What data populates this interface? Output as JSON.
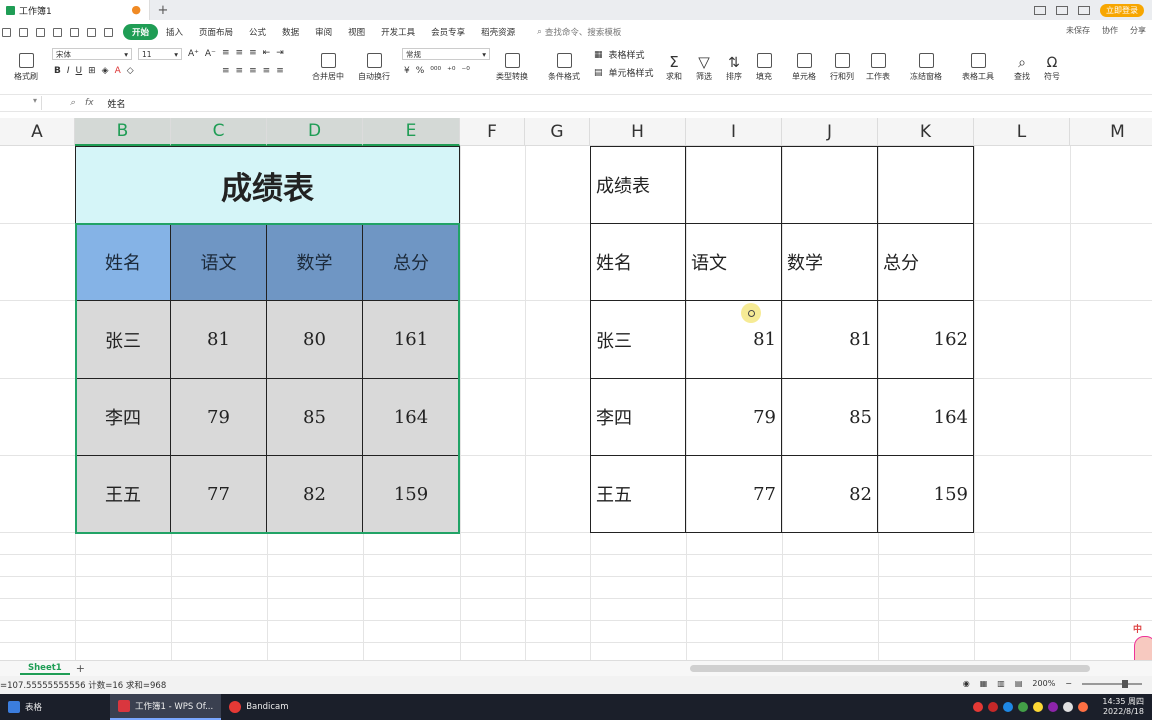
{
  "window": {
    "doc_tab": "工作簿1",
    "unsaved_dot": "●",
    "new_tab": "+",
    "member_btn": "立即登录"
  },
  "menu": {
    "items": [
      "开始",
      "插入",
      "页面布局",
      "公式",
      "数据",
      "审阅",
      "视图",
      "开发工具",
      "会员专享",
      "稻壳资源"
    ],
    "active_index": 0,
    "search_placeholder": "查找命令、搜索模板",
    "right": [
      "未保存",
      "协作",
      "分享"
    ]
  },
  "ribbon": {
    "format_painter": "格式刷",
    "font_name": "宋体",
    "font_size": "11",
    "merge_center": "合并居中",
    "wrap_text": "自动换行",
    "number_format": "常规",
    "type_convert": "类型转换",
    "conditional_format": "条件格式",
    "table_style": "表格样式",
    "cell_style": "单元格样式",
    "sum": "求和",
    "filter": "筛选",
    "sort": "排序",
    "fill": "填充",
    "cell": "单元格",
    "row_col": "行和列",
    "worksheet": "工作表",
    "freeze": "冻结窗格",
    "table_tools": "表格工具",
    "find": "查找",
    "symbol": "符号"
  },
  "formula_bar": {
    "fx": "fx",
    "value": "姓名"
  },
  "columns": [
    "A",
    "B",
    "C",
    "D",
    "E",
    "F",
    "G",
    "H",
    "I",
    "J",
    "K",
    "L",
    "M"
  ],
  "left_table": {
    "title": "成绩表",
    "headers": [
      "姓名",
      "语文",
      "数学",
      "总分"
    ],
    "rows": [
      [
        "张三",
        "81",
        "80",
        "161"
      ],
      [
        "李四",
        "79",
        "85",
        "164"
      ],
      [
        "王五",
        "77",
        "82",
        "159"
      ]
    ]
  },
  "right_table": {
    "title": "成绩表",
    "headers": [
      "姓名",
      "语文",
      "数学",
      "总分"
    ],
    "rows": [
      [
        "张三",
        "81",
        "81",
        "162"
      ],
      [
        "李四",
        "79",
        "85",
        "164"
      ],
      [
        "王五",
        "77",
        "82",
        "159"
      ]
    ]
  },
  "sheets": {
    "active": "Sheet1",
    "add": "+"
  },
  "status": {
    "summary": "=107.55555555556  计数=16  求和=968",
    "zoom": "200%"
  },
  "taskbar": {
    "items": [
      "表格",
      "工作簿1 - WPS Of...",
      "Bandicam"
    ],
    "time": "14:35 周四",
    "date": "2022/8/18",
    "ime": "中"
  },
  "colors": {
    "accent": "#1f9d55",
    "title_fill": "#d5f5f8",
    "header_fill": "#6f96c4",
    "header_first_fill": "#85b3e6",
    "body_fill": "#d9d9d9"
  }
}
